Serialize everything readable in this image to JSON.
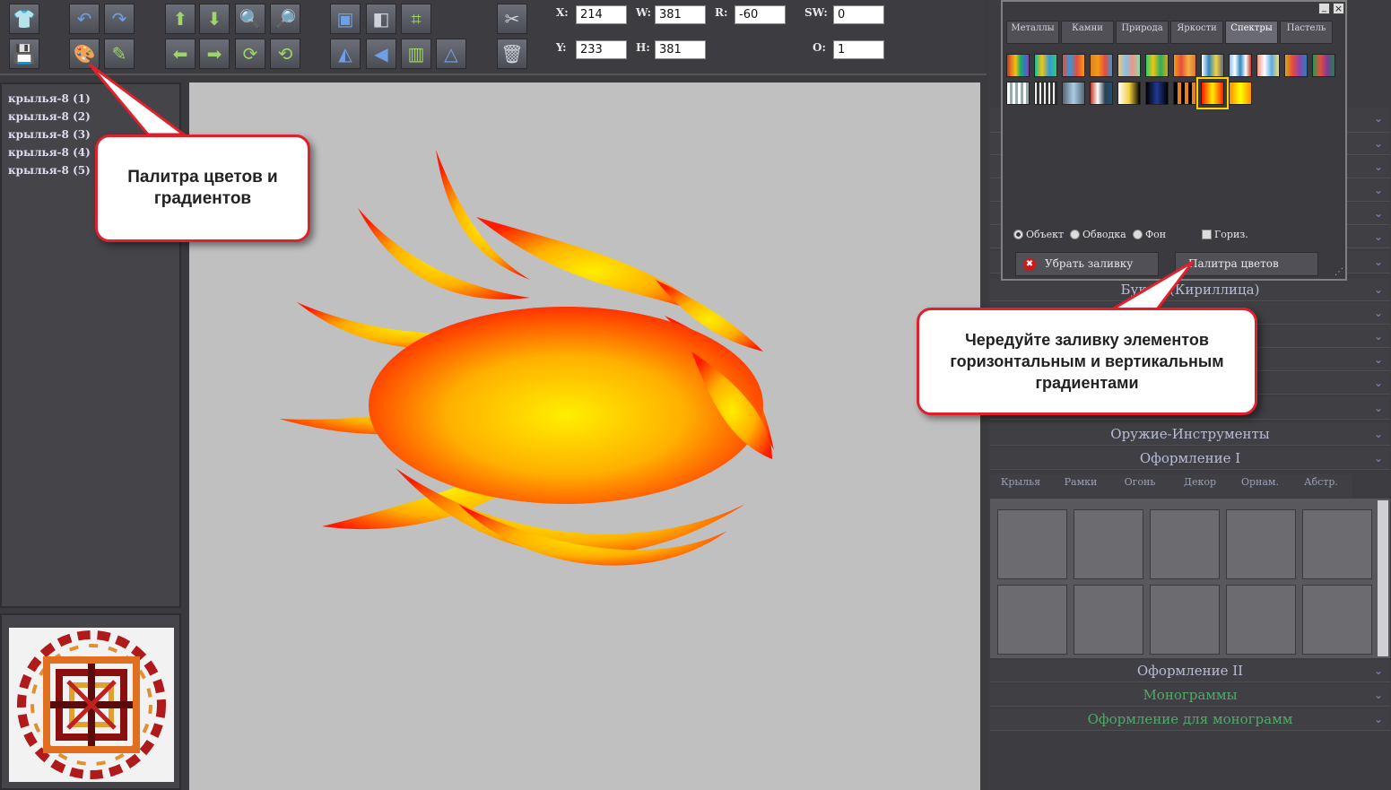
{
  "toolbar": {
    "tools_row1": [
      "tshirt-icon",
      "undo-icon",
      "redo-icon",
      "move-up-icon",
      "move-down-icon",
      "zoom-in-icon",
      "zoom-out-icon",
      "bring-front-icon",
      "send-back-icon",
      "crop-icon",
      "tools-icon"
    ],
    "tools_row2": [
      "save-icon",
      "palette-icon",
      "edit-icon",
      "move-left-icon",
      "move-right-icon",
      "rotate-cw-icon",
      "rotate-ccw-icon",
      "flip-h-icon",
      "flip-v-icon",
      "mirror-icon",
      "triangle-icon",
      "trash-icon"
    ]
  },
  "coords": {
    "x_label": "X:",
    "x_value": "214",
    "y_label": "Y:",
    "y_value": "233",
    "w_label": "W:",
    "w_value": "381",
    "h_label": "H:",
    "h_value": "381",
    "r_label": "R:",
    "r_value": "-60",
    "sw_label": "SW:",
    "sw_value": "0",
    "o_label": "O:",
    "o_value": "1"
  },
  "layers": [
    "крылья-8 (1)",
    "крылья-8 (2)",
    "крылья-8 (3)",
    "крылья-8 (4)",
    "крылья-8 (5)"
  ],
  "palette": {
    "tabs": [
      "Металлы",
      "Камни",
      "Природа",
      "Яркости",
      "Спектры",
      "Пастель"
    ],
    "active_tab": "Спектры",
    "radio_object": "Объект",
    "radio_stroke": "Обводка",
    "radio_bg": "Фон",
    "checkbox_horiz": "Гориз.",
    "remove_fill": "Убрать заливку",
    "color_palette": "Палитра цветов",
    "minimize": "_",
    "close": "×",
    "selected_swatch": 7
  },
  "accordion": {
    "letters_cyr": "Буквы (Кириллица)",
    "weapons": "Оружие-Инструменты",
    "design1": "Оформление I",
    "design2": "Оформление II",
    "monograms": "Монограммы",
    "monogram_design": "Оформление для монограмм"
  },
  "wing_tabs": [
    "Крылья",
    "Рамки",
    "Огонь",
    "Декор",
    "Орнам.",
    "Абстр."
  ],
  "callouts": {
    "palette_hint": "Палитра цветов и градиентов",
    "alternate_hint": "Чередуйте заливку элементов горизонтальным и вертикальным градиентами"
  },
  "colors": {
    "accent_red": "#e0202a",
    "flame_yellow": "#ffee00",
    "flame_red": "#ff1a00"
  }
}
